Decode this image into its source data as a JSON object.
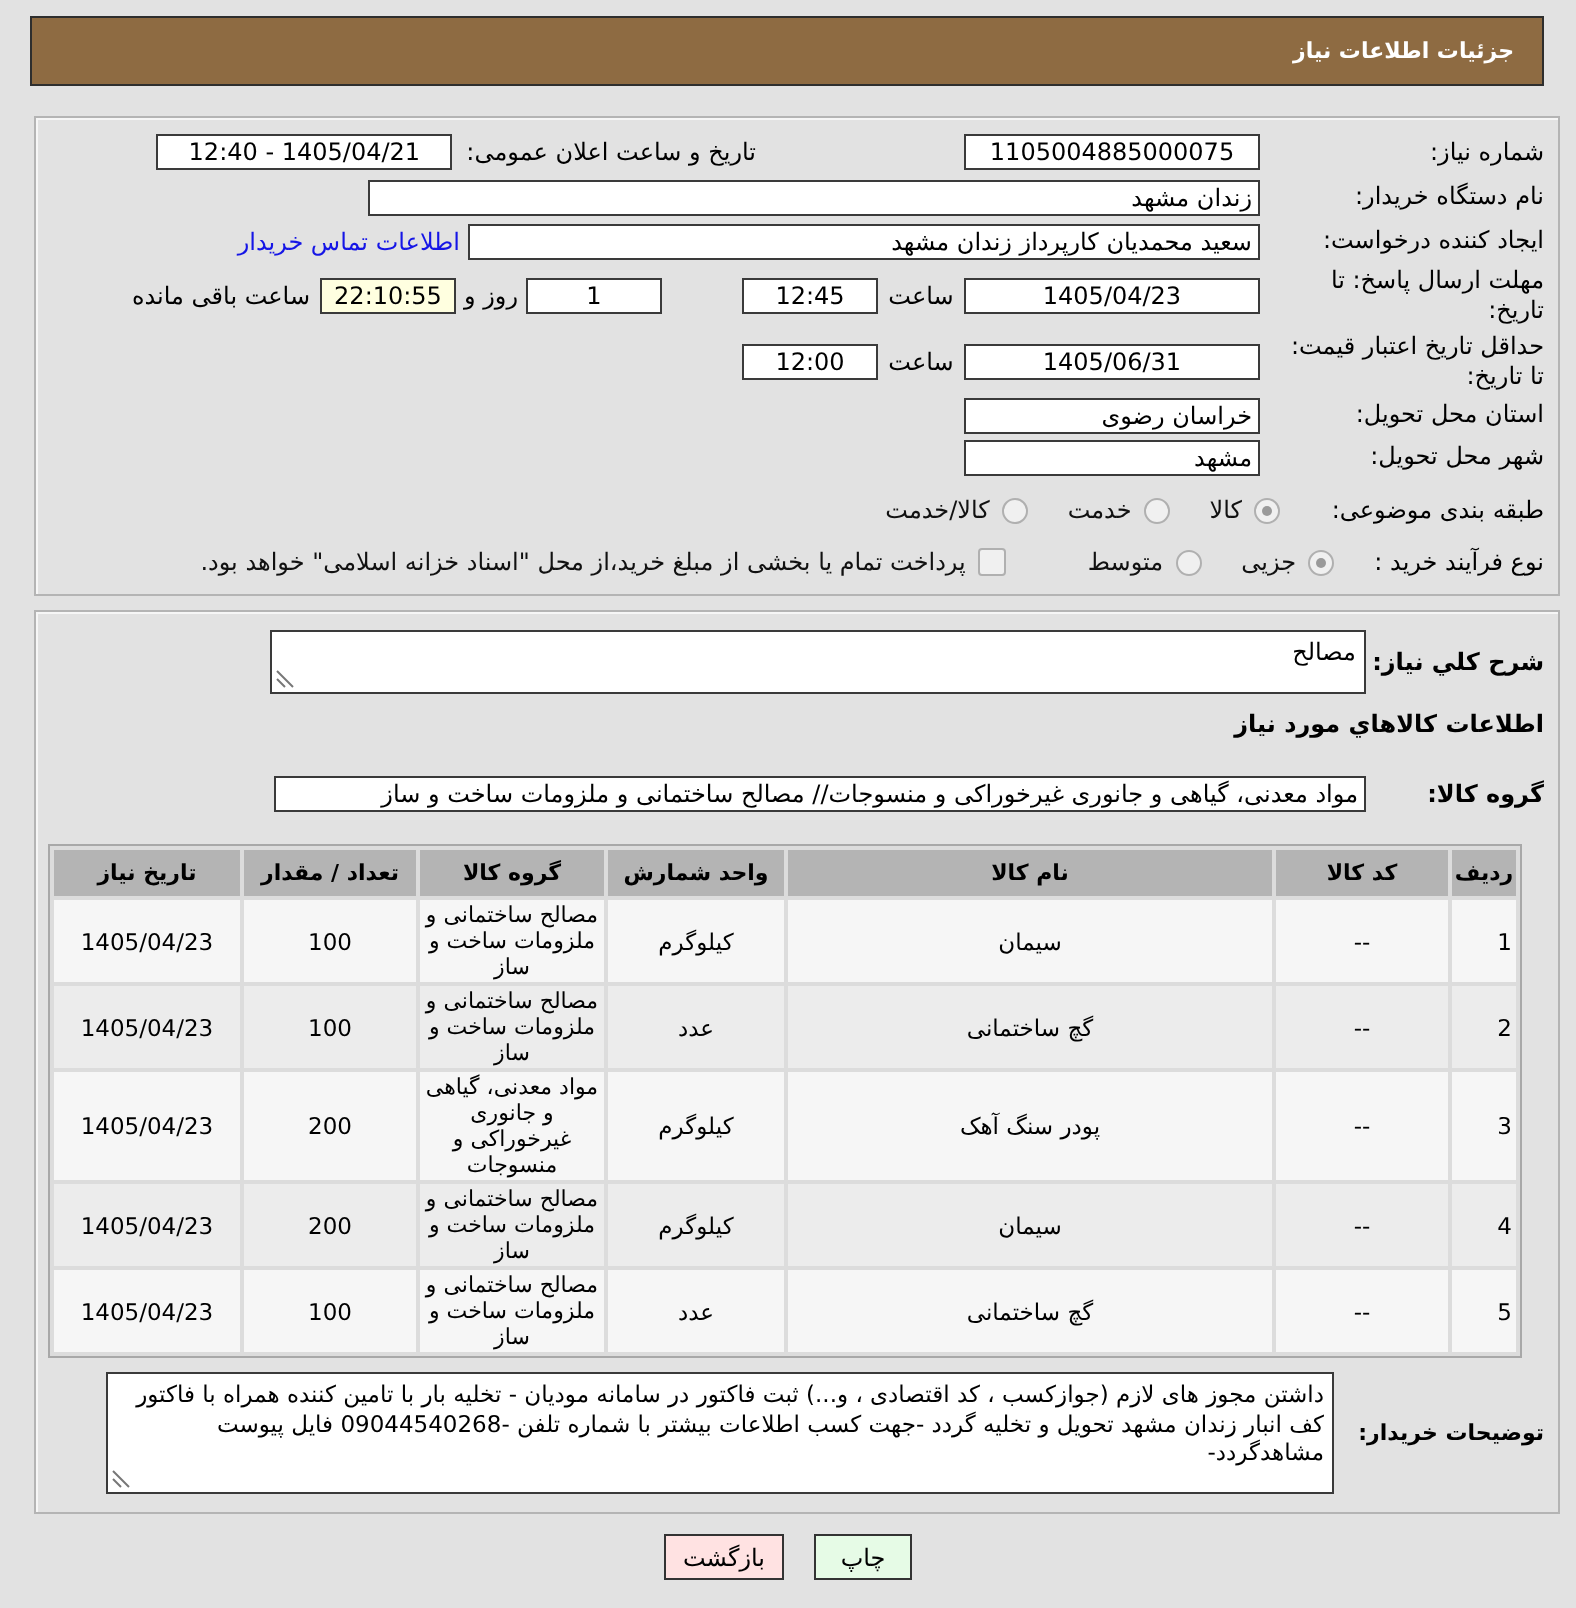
{
  "header": {
    "title": "جزئیات اطلاعات نیاز"
  },
  "summary": {
    "need_number": {
      "label": "شماره نیاز:",
      "value": "1105004885000075"
    },
    "announce_datetime": {
      "label": "تاریخ و ساعت اعلان عمومی:",
      "value": "1405/04/21 - 12:40"
    },
    "buyer_org": {
      "label": "نام دستگاه خریدار:",
      "value": "زندان مشهد"
    },
    "requester": {
      "label": "ایجاد کننده درخواست:",
      "value": "سعید محمدیان کارپرداز زندان مشهد",
      "link": "اطلاعات تماس خریدار"
    },
    "reply_deadline": {
      "label": "مهلت ارسال پاسخ: تا تاریخ:",
      "date": "1405/04/23",
      "time_label": "ساعت",
      "time": "12:45",
      "days": "1",
      "days_label": "روز و",
      "remaining": "22:10:55",
      "remaining_label": "ساعت باقی مانده"
    },
    "price_validity": {
      "label": "حداقل تاریخ اعتبار قیمت: تا تاریخ:",
      "date": "1405/06/31",
      "time_label": "ساعت",
      "time": "12:00"
    },
    "province": {
      "label": "استان محل تحویل:",
      "value": "خراسان رضوی"
    },
    "city": {
      "label": "شهر محل تحویل:",
      "value": "مشهد"
    },
    "category": {
      "label": "طبقه بندی موضوعی:",
      "options": [
        {
          "label": "کالا",
          "selected": true
        },
        {
          "label": "خدمت",
          "selected": false
        },
        {
          "label": "کالا/خدمت",
          "selected": false
        }
      ]
    },
    "purchase_type": {
      "label": "نوع فرآیند خرید :",
      "options": [
        {
          "label": "جزیی",
          "selected": true
        },
        {
          "label": "متوسط",
          "selected": false
        }
      ],
      "treasury": {
        "label": "پرداخت تمام یا بخشی از مبلغ خرید،از محل \"اسناد خزانه اسلامی\" خواهد بود.",
        "checked": false
      }
    }
  },
  "details": {
    "description": {
      "label": "شرح کلي نیاز:",
      "value": "مصالح"
    },
    "goods_heading": "اطلاعات کالاهاي مورد نیاز",
    "goods_group": {
      "label": "گروه کالا:",
      "value": "مواد معدنی، گیاهی و جانوری غیرخوراکی و منسوجات// مصالح ساختمانی و ملزومات ساخت و ساز"
    },
    "table": {
      "columns": [
        "ردیف",
        "کد کالا",
        "نام کالا",
        "واحد شمارش",
        "گروه کالا",
        "تعداد / مقدار",
        "تاریخ نیاز"
      ],
      "rows": [
        {
          "row_number": "1",
          "item_code": "--",
          "item_name": "سیمان",
          "unit": "کیلوگرم",
          "group": "مصالح ساختمانی و ملزومات ساخت و ساز",
          "quantity": "100",
          "need_date": "1405/04/23"
        },
        {
          "row_number": "2",
          "item_code": "--",
          "item_name": "گچ ساختمانی",
          "unit": "عدد",
          "group": "مصالح ساختمانی و ملزومات ساخت و ساز",
          "quantity": "100",
          "need_date": "1405/04/23"
        },
        {
          "row_number": "3",
          "item_code": "--",
          "item_name": "پودر سنگ آهک",
          "unit": "کیلوگرم",
          "group": "مواد معدنی، گیاهی و جانوری غیرخوراکی و منسوجات",
          "quantity": "200",
          "need_date": "1405/04/23"
        },
        {
          "row_number": "4",
          "item_code": "--",
          "item_name": "سیمان",
          "unit": "کیلوگرم",
          "group": "مصالح ساختمانی و ملزومات ساخت و ساز",
          "quantity": "200",
          "need_date": "1405/04/23"
        },
        {
          "row_number": "5",
          "item_code": "--",
          "item_name": "گچ ساختمانی",
          "unit": "عدد",
          "group": "مصالح ساختمانی و ملزومات ساخت و ساز",
          "quantity": "100",
          "need_date": "1405/04/23"
        }
      ]
    },
    "buyer_notes": {
      "label": "توضیحات خریدار:",
      "value": "داشتن مجوز های لازم (جوازکسب ، کد اقتصادی ، و...) ثبت فاکتور در سامانه مودیان - تخلیه بار با تامین کننده همراه با فاکتور کف انبار زندان مشهد تحویل و تخلیه گردد -جهت کسب اطلاعات بیشتر با شماره تلفن -09044540268 فایل پیوست مشاهدگردد-"
    }
  },
  "buttons": [
    {
      "label": "چاپ",
      "kind": "print"
    },
    {
      "label": "بازگشت",
      "kind": "back"
    }
  ]
}
